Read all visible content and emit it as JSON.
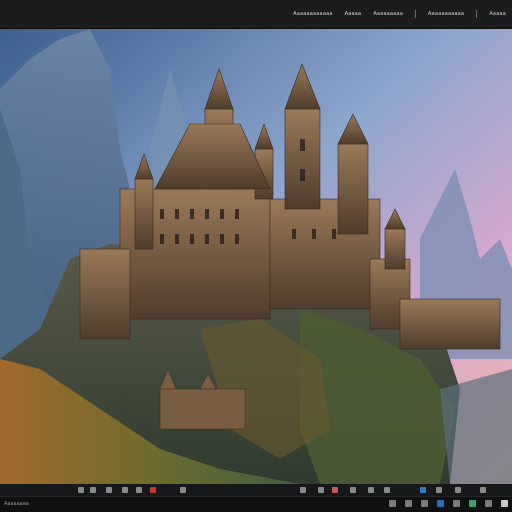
{
  "topbar": {
    "menu": [
      {
        "label": "Aaaaaaaaaaaa"
      },
      {
        "label": "Aaaaa"
      },
      {
        "label": "Aaaaaaaaa"
      },
      {
        "label": "Aaaaaaaaaaa"
      },
      {
        "label": "Aaaaa"
      }
    ]
  },
  "viewer": {
    "image_subject": "fantasy castle on cliff at sunset"
  },
  "taskbar": {
    "label": "Aaaaaaaa"
  },
  "colors": {
    "sky_top": "#5b7fb0",
    "sky_pink": "#e6a6c8",
    "castle": "#7a5a3f",
    "foliage": "#8a6a2e"
  }
}
